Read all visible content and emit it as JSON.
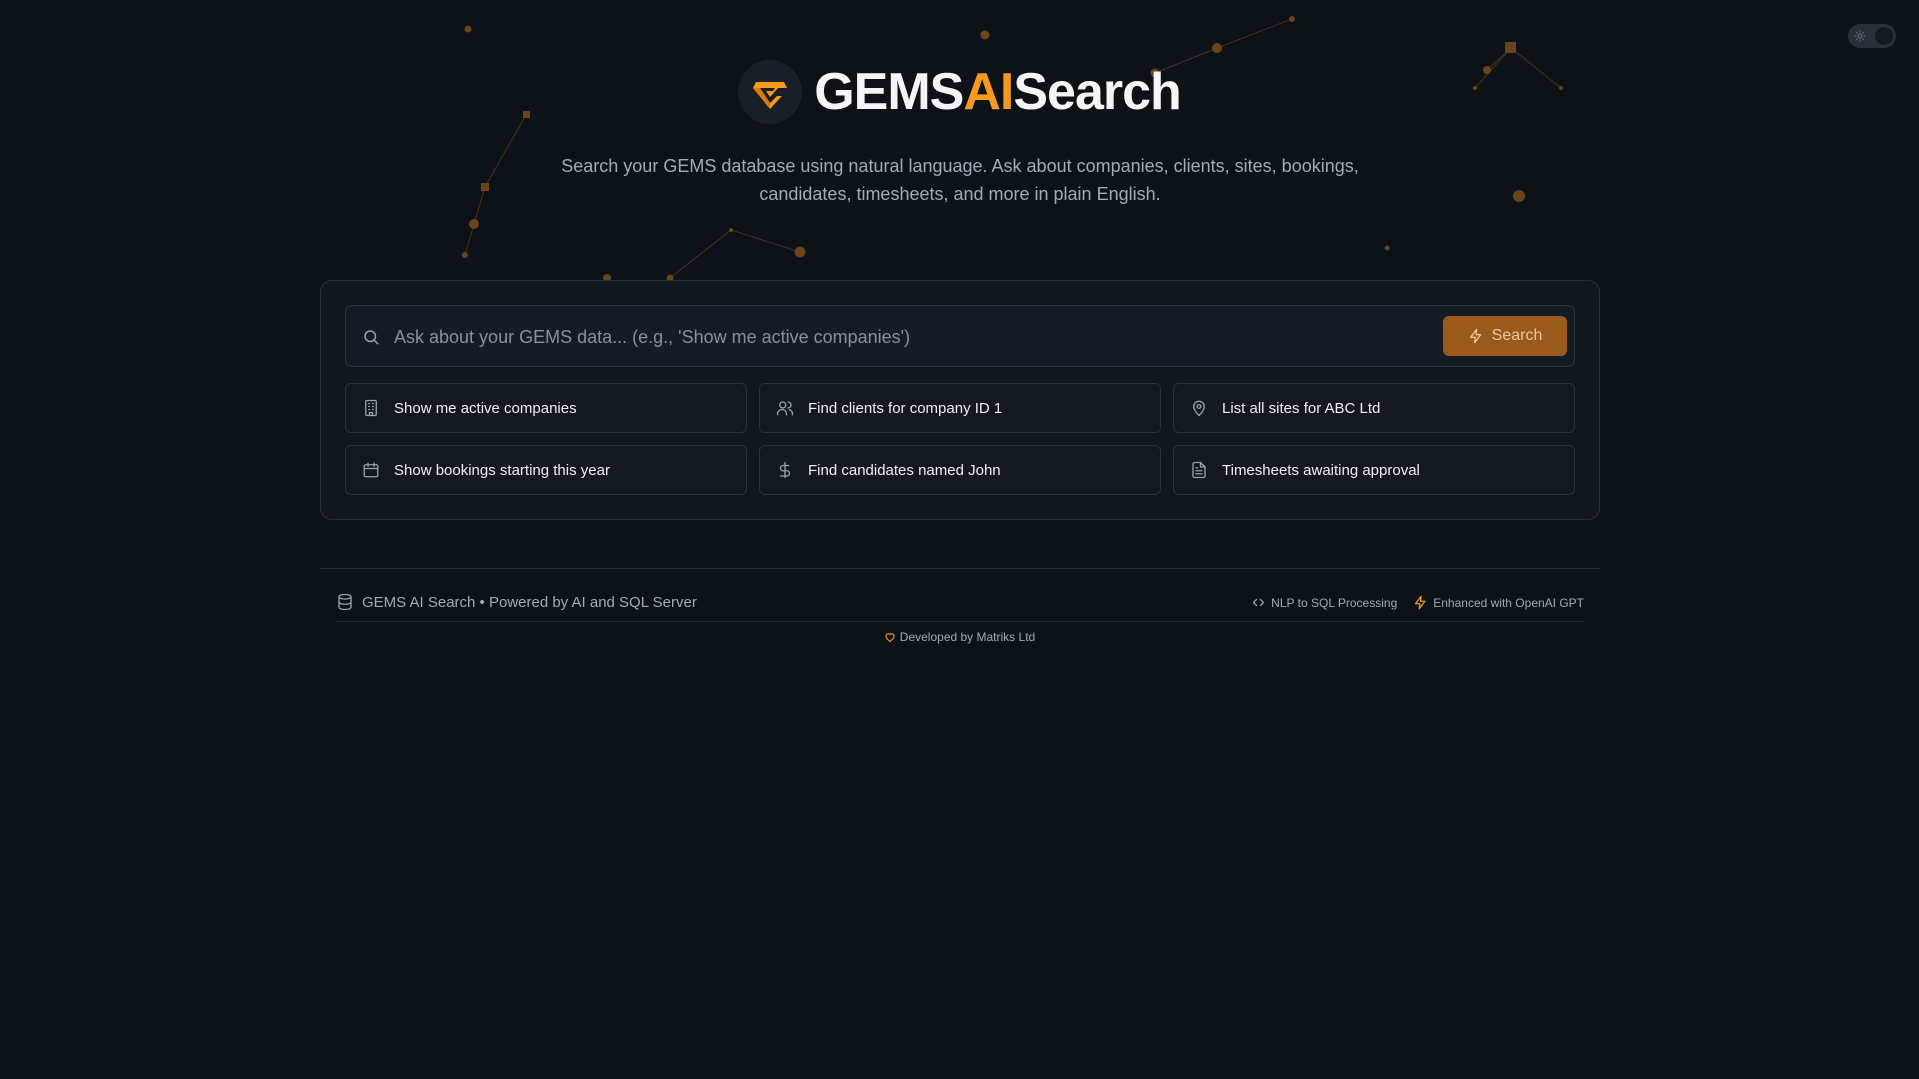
{
  "brand": {
    "title_part1": "GEMS",
    "title_part2": "AI",
    "title_part3": "Search",
    "accent_color": "#f59a1c"
  },
  "subtitle": "Search your GEMS database using natural language. Ask about companies, clients, sites, bookings, candidates, timesheets, and more in plain English.",
  "search": {
    "placeholder": "Ask about your GEMS data... (e.g., 'Show me active companies')",
    "value": "",
    "button_label": "Search",
    "button_icon": "lightning-icon"
  },
  "suggestions": [
    {
      "label": "Show me active companies",
      "icon": "building-icon"
    },
    {
      "label": "Find clients for company ID 1",
      "icon": "users-icon"
    },
    {
      "label": "List all sites for ABC Ltd",
      "icon": "map-pin-icon"
    },
    {
      "label": "Show bookings starting this year",
      "icon": "calendar-icon"
    },
    {
      "label": "Find candidates named John",
      "icon": "dollar-icon"
    },
    {
      "label": "Timesheets awaiting approval",
      "icon": "document-icon"
    }
  ],
  "footer": {
    "left_text": "GEMS AI Search • Powered by AI and SQL Server",
    "nlp_label": "NLP to SQL Processing",
    "openai_label": "Enhanced with OpenAI GPT",
    "developed_by": "Developed by Matriks Ltd"
  },
  "theme_toggle": {
    "mode": "dark",
    "icon": "sun-icon"
  }
}
